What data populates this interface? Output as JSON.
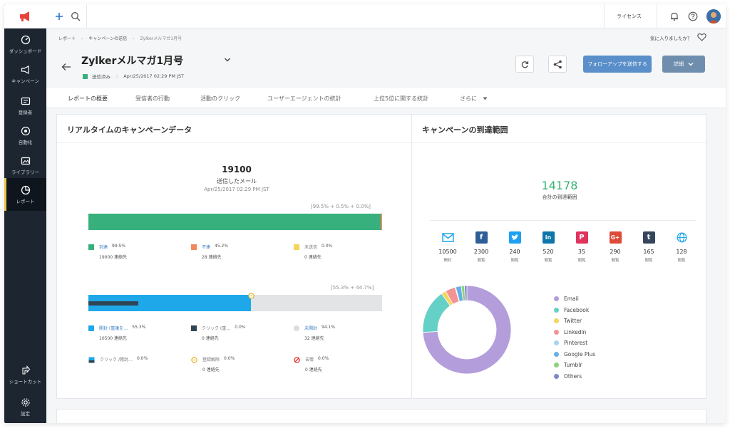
{
  "topbar": {
    "license_label": "ライセンス"
  },
  "sidebar": {
    "items": [
      {
        "label": "ダッシュボード",
        "icon": "dashboard-icon"
      },
      {
        "label": "キャンペーン",
        "icon": "megaphone-icon"
      },
      {
        "label": "登録者",
        "icon": "contacts-icon"
      },
      {
        "label": "自動化",
        "icon": "automation-icon"
      },
      {
        "label": "ライブラリー",
        "icon": "library-icon"
      },
      {
        "label": "レポート",
        "icon": "report-icon"
      }
    ],
    "bottom_items": [
      {
        "label": "ショートカット",
        "icon": "shortcut-icon"
      },
      {
        "label": "設定",
        "icon": "gear-icon"
      }
    ],
    "active_index": 5
  },
  "breadcrumb": [
    "レポート",
    "キャンペーンの送信",
    "Zylkerメルマガ1月号"
  ],
  "favorite_prompt": "気に入りましたか？",
  "header": {
    "title": "Zylkerメルマガ1月号",
    "status": "送信済み",
    "status_date": "Apr/25/2017 02:29 PM JST",
    "send_followup": "フォローアップを送信する",
    "details": "詳細"
  },
  "tabs": [
    "レポートの概要",
    "受信者の行動",
    "活動のクリック",
    "ユーザーエージェントの統計",
    "上位5位に関する統計",
    "さらに"
  ],
  "realtime": {
    "title": "リアルタイムのキャンペーンデータ",
    "sent_count": "19100",
    "sent_label": "送信したメール",
    "sent_date": "Apr/25/2017 02:29 PM JST",
    "delivery_bracket": "[99.5% + 0.5% + 0.0%]",
    "delivery_fractions": [
      0.995,
      0.005,
      0.0
    ],
    "delivery_legend": [
      {
        "name": "到達",
        "pct": "99.5%",
        "sub": "19000 連絡先",
        "color": "#38b07d",
        "link": true
      },
      {
        "name": "不達",
        "pct": "45.2%",
        "sub": "28 連絡先",
        "color": "#f08a5d",
        "link": true
      },
      {
        "name": "未送信",
        "pct": "0.0%",
        "sub": "0 連絡先",
        "color": "#f5d55c",
        "link": false
      }
    ],
    "open_bracket": "[55.3% + 44.7%]",
    "open_fractions": {
      "opened": 0.553,
      "unopened": 0.447,
      "click_marker": 0.17
    },
    "open_legend": [
      {
        "name": "開封 (重複を…",
        "pct": "55.3%",
        "sub": "10500 連絡先",
        "color": "#1ea8ea",
        "link": true
      },
      {
        "name": "クリック (重…",
        "pct": "0.0%",
        "sub": "0 連絡先",
        "color": "#2f4556",
        "link": false
      },
      {
        "name": "未開封",
        "pct": "94.1%",
        "sub": "32 連絡先",
        "color": "#dadcde",
        "link": true
      },
      {
        "name": "クリック /開封…",
        "pct": "0.0%",
        "sub": "",
        "color": "#1ea8ea",
        "link": false
      },
      {
        "name": "登録解除",
        "pct": "0.0%",
        "sub": "0 連絡先",
        "color": "#e8b52a",
        "link": false
      },
      {
        "name": "苦情",
        "pct": "0.0%",
        "sub": "0 連絡先",
        "color": "#e53935",
        "link": false
      }
    ]
  },
  "reach": {
    "title": "キャンペーンの到達範囲",
    "total": "14178",
    "total_label": "合計の到達範囲",
    "channels": [
      {
        "name": "Email",
        "value": "10500",
        "label": "開封",
        "color": "#1ea8ea",
        "icon": "email-icon",
        "glyph": "✉"
      },
      {
        "name": "Facebook",
        "value": "2300",
        "label": "閲覧",
        "color": "#2d5e96",
        "icon": "facebook-icon",
        "glyph": "f"
      },
      {
        "name": "Twitter",
        "value": "240",
        "label": "閲覧",
        "color": "#1da1f2",
        "icon": "twitter-icon",
        "glyph": "t"
      },
      {
        "name": "LinkedIn",
        "value": "520",
        "label": "閲覧",
        "color": "#0e76a8",
        "icon": "linkedin-icon",
        "glyph": "in"
      },
      {
        "name": "Pinterest",
        "value": "35",
        "label": "閲覧",
        "color": "#e0335d",
        "icon": "pinterest-icon",
        "glyph": "P"
      },
      {
        "name": "Google Plus",
        "value": "290",
        "label": "閲覧",
        "color": "#dd4b39",
        "icon": "google-plus-icon",
        "glyph": "G+"
      },
      {
        "name": "Tumblr",
        "value": "165",
        "label": "閲覧",
        "color": "#35465c",
        "icon": "tumblr-icon",
        "glyph": "t"
      },
      {
        "name": "Others",
        "value": "128",
        "label": "閲覧",
        "color": "#1ea8ea",
        "icon": "globe-icon",
        "glyph": "◎"
      }
    ]
  },
  "chart_data": {
    "type": "pie",
    "categories": [
      "Email",
      "Facebook",
      "Twitter",
      "LinkedIn",
      "Pinterest",
      "Google Plus",
      "Tumblr",
      "Others"
    ],
    "values": [
      10500,
      2300,
      240,
      520,
      35,
      290,
      165,
      128
    ],
    "colors": [
      "#b39ddb",
      "#64d0c6",
      "#f5d55c",
      "#f49393",
      "#a7d3ef",
      "#6aaee6",
      "#8fd17a",
      "#7f86c9"
    ],
    "legend": "right"
  }
}
